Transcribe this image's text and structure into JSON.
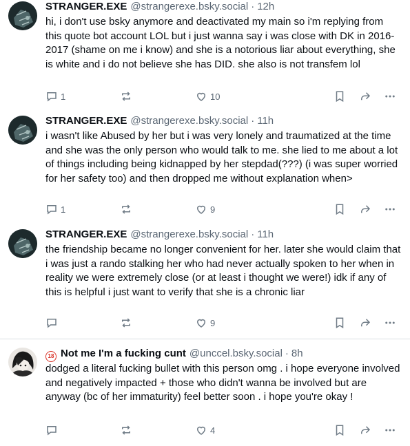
{
  "posts": [
    {
      "name": "STRANGER.EXE",
      "handle": "@strangerexe.bsky.social",
      "time": "12h",
      "text": "hi, i don't use bsky anymore and deactivated my main so i'm replying from this quote bot account LOL but i just wanna say i was close with DK in 2016-2017 (shame on me i know) and she is a notorious liar about everything, she is white and i do not believe she has DID. she also is not transfem lol",
      "replies": "1",
      "likes": "10"
    },
    {
      "name": "STRANGER.EXE",
      "handle": "@strangerexe.bsky.social",
      "time": "11h",
      "text": "i wasn't like Abused by her but i was very lonely and traumatized at the time and she was the only person who would talk to me. she lied to me about a lot of things including being kidnapped by her stepdad(???) (i was super worried for her safety too) and then dropped me without explanation when>",
      "replies": "1",
      "likes": "9"
    },
    {
      "name": "STRANGER.EXE",
      "handle": "@strangerexe.bsky.social",
      "time": "11h",
      "text": "the friendship became no longer convenient for her. later she would claim that i was just a rando stalking her who had never actually spoken to her when in reality we were extremely close (or at least i thought we were!) idk if any of this is helpful i just want to verify that she is a chronic liar",
      "replies": "",
      "likes": "9"
    },
    {
      "badge": "18",
      "name": "Not me I'm a fucking cunt",
      "handle": "@unccel.bsky.social",
      "time": "8h",
      "text": "dodged a literal fucking bullet with this person omg . i hope everyone involved and negatively impacted + those who didn't wanna be involved but are anyway (bc of her immaturity) feel better soon . i hope you're okay !",
      "replies": "",
      "likes": "4"
    }
  ],
  "separator": "·",
  "colors": {
    "text": "#0b0f14",
    "muted": "#5b6774",
    "icon": "#6f7b86",
    "divider": "#d9dee3",
    "badge": "#d93025"
  },
  "icons": {
    "reply": "reply-icon",
    "repost": "repost-icon",
    "like": "heart-icon",
    "bookmark": "bookmark-icon",
    "share": "share-icon",
    "more": "more-icon"
  }
}
